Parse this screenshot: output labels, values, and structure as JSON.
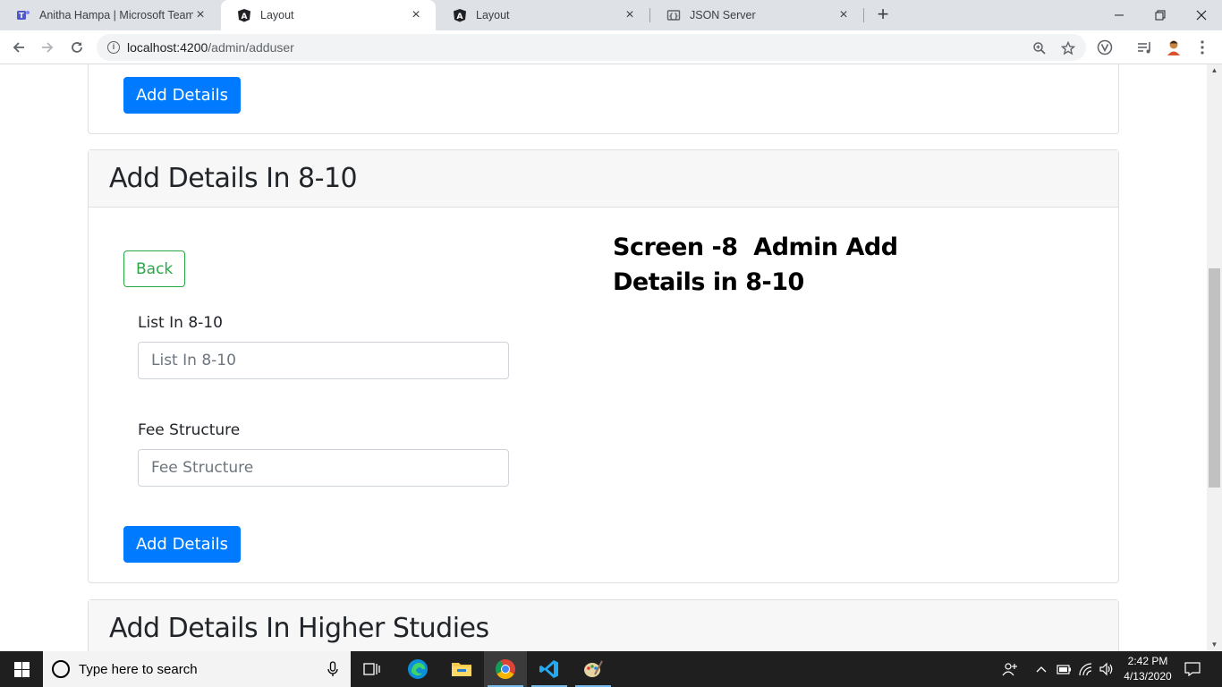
{
  "browser": {
    "tabs": [
      {
        "title": "Anitha Hampa | Microsoft Teams",
        "icon": "teams-icon",
        "active": false
      },
      {
        "title": "Layout",
        "icon": "angular-icon",
        "active": true
      },
      {
        "title": "Layout",
        "icon": "angular-icon",
        "active": false
      },
      {
        "title": "JSON Server",
        "icon": "json-server-icon",
        "active": false
      }
    ],
    "url_host": "localhost:4200",
    "url_path": "/admin/adduser"
  },
  "page": {
    "top_card": {
      "button_label": "Add Details"
    },
    "main_card": {
      "title": "Add Details In 8-10",
      "back_label": "Back",
      "annotation_line1": "Screen -8  Admin Add",
      "annotation_line2": "Details in 8-10",
      "list_label": "List In 8-10",
      "list_placeholder": "List In 8-10",
      "fee_label": "Fee Structure",
      "fee_placeholder": "Fee Structure",
      "submit_label": "Add Details"
    },
    "bottom_card": {
      "title": "Add Details In Higher Studies"
    }
  },
  "taskbar": {
    "search_placeholder": "Type here to search",
    "time": "2:42 PM",
    "date": "4/13/2020"
  },
  "colors": {
    "primary": "#007bff",
    "success": "#28a745",
    "card_header_bg": "#f7f7f7"
  }
}
